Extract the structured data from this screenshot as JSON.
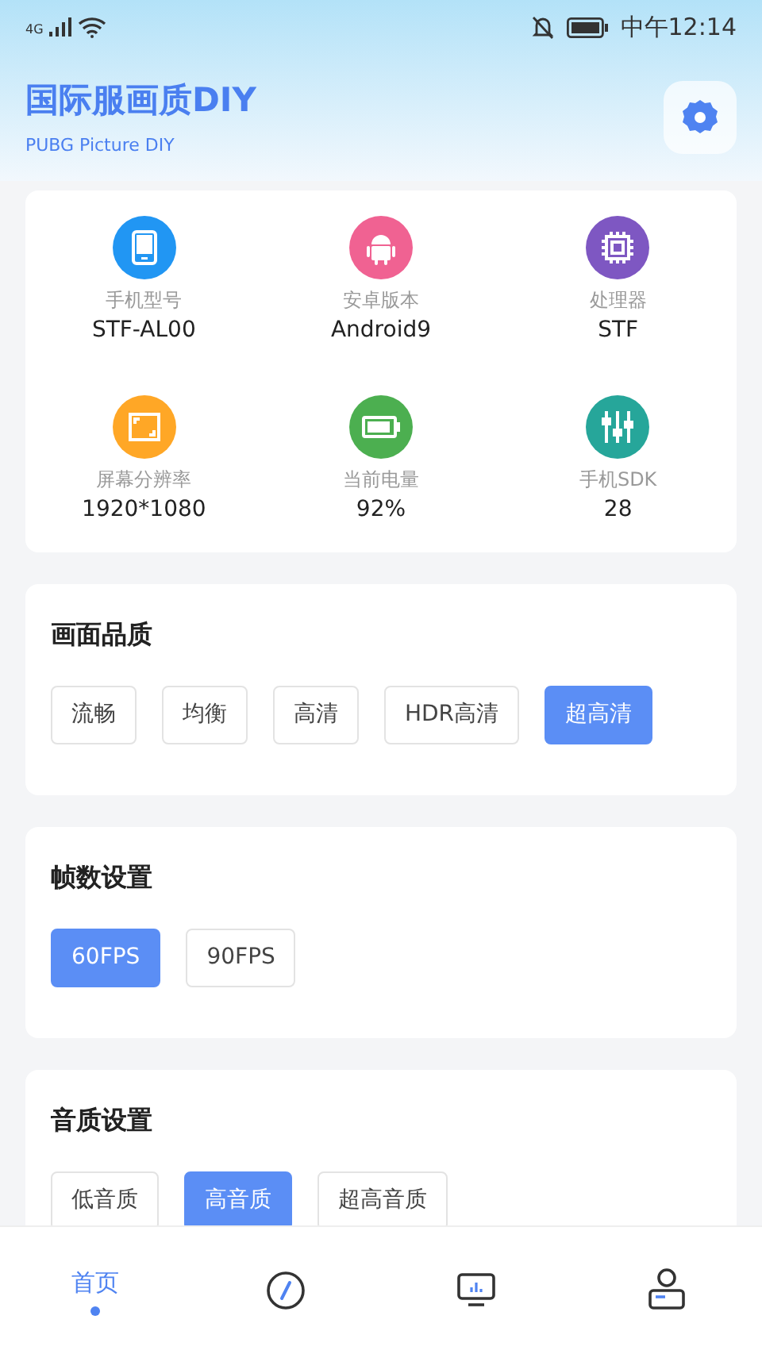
{
  "status_bar": {
    "network": "4G",
    "time": "中午12:14"
  },
  "header": {
    "title": "国际服画质DIY",
    "subtitle": "PUBG Picture DIY"
  },
  "device_info": [
    {
      "label": "手机型号",
      "value": "STF-AL00",
      "color": "#2196f3"
    },
    {
      "label": "安卓版本",
      "value": "Android9",
      "color": "#f06292"
    },
    {
      "label": "处理器",
      "value": "STF",
      "color": "#7e57c2"
    },
    {
      "label": "屏幕分辨率",
      "value": "1920*1080",
      "color": "#ffa726"
    },
    {
      "label": "当前电量",
      "value": "92%",
      "color": "#4caf50"
    },
    {
      "label": "手机SDK",
      "value": "28",
      "color": "#26a69a"
    }
  ],
  "sections": [
    {
      "title": "画面品质",
      "options": [
        {
          "label": "流畅",
          "selected": false
        },
        {
          "label": "均衡",
          "selected": false
        },
        {
          "label": "高清",
          "selected": false
        },
        {
          "label": "HDR高清",
          "selected": false
        },
        {
          "label": "超高清",
          "selected": true
        }
      ]
    },
    {
      "title": "帧数设置",
      "options": [
        {
          "label": "60FPS",
          "selected": true
        },
        {
          "label": "90FPS",
          "selected": false
        }
      ]
    },
    {
      "title": "音质设置",
      "options": [
        {
          "label": "低音质",
          "selected": false
        },
        {
          "label": "高音质",
          "selected": true
        },
        {
          "label": "超高音质",
          "selected": false
        }
      ]
    }
  ],
  "bottom_nav": [
    {
      "kind": "label",
      "label": "首页",
      "selected": true
    },
    {
      "kind": "compass",
      "selected": false
    },
    {
      "kind": "monitor",
      "selected": false
    },
    {
      "kind": "user",
      "selected": false
    }
  ]
}
